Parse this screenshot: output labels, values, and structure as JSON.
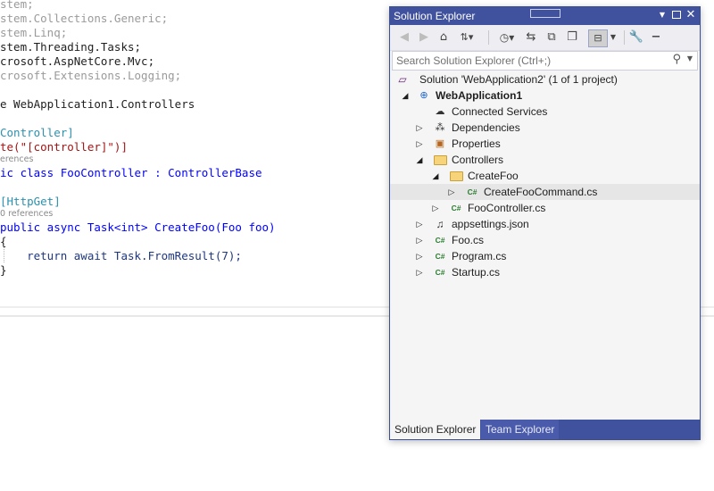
{
  "editor": {
    "lines": [
      "stem;",
      "stem.Collections.Generic;",
      "stem.Linq;",
      "stem.Threading.Tasks;",
      "crosoft.AspNetCore.Mvc;",
      "crosoft.Extensions.Logging;",
      "e WebApplication1.Controllers",
      "Controller]",
      "te(\"[controller]\")]",
      "erences",
      "ic class FooController : ControllerBase",
      "[HttpGet]",
      "0 references",
      "public async Task<int> CreateFoo(Foo foo)",
      "{",
      "    return await Task.FromResult(7);",
      "}"
    ]
  },
  "solution_explorer": {
    "title": "Solution Explorer",
    "search_placeholder": "Search Solution Explorer (Ctrl+;)",
    "toolbar_icons": [
      "back-icon",
      "forward-icon",
      "home-icon",
      "sync-icon",
      "history-icon",
      "pending-changes-icon",
      "collapse-all-icon",
      "show-all-files-icon",
      "preview-icon",
      "properties-icon"
    ],
    "tree": [
      {
        "label": "Solution 'WebApplication2' (1 of 1 project)",
        "icon": "solution-icon",
        "depth": 0,
        "expander": ""
      },
      {
        "label": "WebApplication1",
        "icon": "web-project-icon",
        "depth": 1,
        "expander": "open",
        "bold": true
      },
      {
        "label": "Connected Services",
        "icon": "cloud-icon",
        "depth": 2,
        "expander": ""
      },
      {
        "label": "Dependencies",
        "icon": "dependencies-icon",
        "depth": 2,
        "expander": "closed"
      },
      {
        "label": "Properties",
        "icon": "properties-folder-icon",
        "depth": 2,
        "expander": "closed"
      },
      {
        "label": "Controllers",
        "icon": "folder-icon",
        "depth": 2,
        "expander": "open"
      },
      {
        "label": "CreateFoo",
        "icon": "folder-icon",
        "depth": 3,
        "expander": "open"
      },
      {
        "label": "CreateFooCommand.cs",
        "icon": "csharp-file-icon",
        "depth": 4,
        "expander": "closed",
        "selected": true
      },
      {
        "label": "FooController.cs",
        "icon": "csharp-file-icon",
        "depth": 3,
        "expander": "closed"
      },
      {
        "label": "appsettings.json",
        "icon": "json-file-icon",
        "depth": 2,
        "expander": "closed"
      },
      {
        "label": "Foo.cs",
        "icon": "csharp-file-icon",
        "depth": 2,
        "expander": "closed"
      },
      {
        "label": "Program.cs",
        "icon": "csharp-file-icon",
        "depth": 2,
        "expander": "closed"
      },
      {
        "label": "Startup.cs",
        "icon": "csharp-file-icon",
        "depth": 2,
        "expander": "closed"
      }
    ],
    "csharp_glyph": "C#",
    "tabs": [
      {
        "label": "Solution Explorer",
        "active": true
      },
      {
        "label": "Team Explorer",
        "active": false
      }
    ]
  },
  "colors": {
    "accent": "#40519d",
    "keyword": "#0000ff",
    "type": "#2b91af",
    "string": "#a31515"
  }
}
